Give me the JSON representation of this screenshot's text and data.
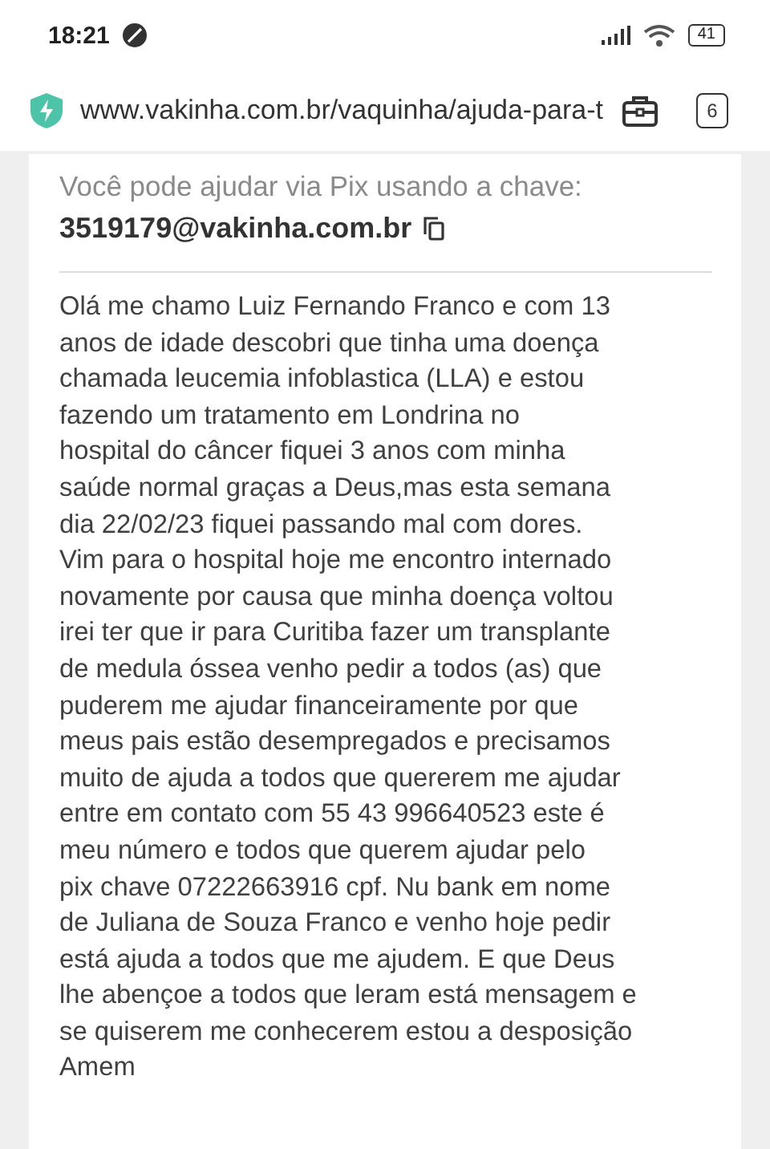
{
  "status_bar": {
    "time": "18:21",
    "battery": "41"
  },
  "browser": {
    "url": "www.vakinha.com.br/vaquinha/ajuda-para-t",
    "tab_count": "6"
  },
  "pix": {
    "label": "Você pode ajudar via Pix usando a chave:",
    "key": "3519179@vakinha.com.br"
  },
  "description_lines": [
    "Olá me chamo Luiz Fernando Franco e com 13",
    "anos de idade descobri que tinha uma doença",
    "chamada leucemia infoblastica (LLA) e estou",
    "fazendo um tratamento em Londrina no",
    "hospital do câncer fiquei 3 anos com minha",
    "saúde normal graças a Deus,mas esta semana",
    "dia 22/02/23 fiquei passando mal com dores.",
    "Vim para o hospital hoje me encontro internado",
    "novamente por causa que minha doença voltou",
    "irei ter que ir para Curitiba fazer um transplante",
    "de medula óssea venho pedir a todos (as) que",
    "puderem me ajudar financeiramente por que",
    "meus pais estão desempregados e precisamos",
    "muito de ajuda a todos que quererem me ajudar",
    "entre em contato com 55 43 996640523 este é",
    "meu número e todos que querem ajudar pelo",
    "pix chave 07222663916 cpf. Nu bank em nome",
    "de Juliana de Souza Franco e venho hoje pedir",
    "está ajuda a todos que me ajudem. E que Deus",
    "lhe abençoe a todos que leram está mensagem e",
    "se quiserem me conhecerem estou a desposição",
    "Amem"
  ]
}
